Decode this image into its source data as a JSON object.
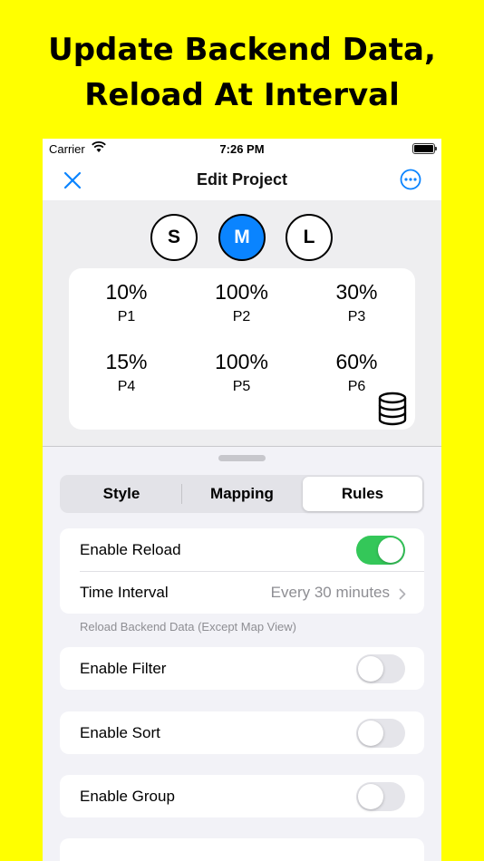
{
  "headline": {
    "line1": "Update Backend Data,",
    "line2": "Reload At Interval"
  },
  "status_bar": {
    "carrier": "Carrier",
    "time": "7:26 PM",
    "battery_level": 1.0
  },
  "nav": {
    "title": "Edit Project",
    "close_icon": "close-icon",
    "more_icon": "ellipsis-circle-icon"
  },
  "accent_color": "#0A84FF",
  "sizes": {
    "options": [
      "S",
      "M",
      "L"
    ],
    "selected": "M"
  },
  "grid": [
    {
      "percent": "10%",
      "label": "P1"
    },
    {
      "percent": "100%",
      "label": "P2"
    },
    {
      "percent": "30%",
      "label": "P3"
    },
    {
      "percent": "15%",
      "label": "P4"
    },
    {
      "percent": "100%",
      "label": "P5"
    },
    {
      "percent": "60%",
      "label": "P6"
    }
  ],
  "grid_icon": "database-icon",
  "tabs": {
    "items": [
      "Style",
      "Mapping",
      "Rules"
    ],
    "selected": "Rules"
  },
  "rules": {
    "enable_reload": {
      "label": "Enable Reload",
      "on": true
    },
    "time_interval": {
      "label": "Time Interval",
      "value": "Every 30 minutes"
    },
    "reload_note": "Reload Backend Data (Except Map View)",
    "enable_filter": {
      "label": "Enable Filter",
      "on": false
    },
    "enable_sort": {
      "label": "Enable Sort",
      "on": false
    },
    "enable_group": {
      "label": "Enable Group",
      "on": false
    }
  },
  "colors": {
    "toggle_on": "#34C759",
    "background": "#FFFF00"
  }
}
